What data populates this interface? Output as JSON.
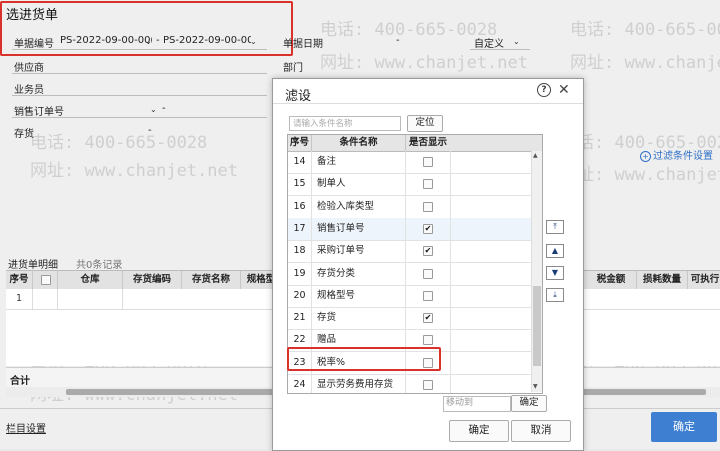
{
  "page": {
    "title": "选进货单",
    "fields": {
      "doc_no_label": "单据编号",
      "doc_no_from": "PS-2022-09-00-00(",
      "doc_no_to": "PS-2022-09-00-00(",
      "doc_date_label": "单据日期",
      "doc_date_sep": "-",
      "custom_label": "自定义",
      "supplier_label": "供应商",
      "department_label": "部门",
      "salesman_label": "业务员",
      "sales_order_label": "销售订单号",
      "sales_order_sep": "-",
      "stock_label": "存货",
      "stock_sep": "-"
    },
    "filter_setting_link": "过滤条件设置",
    "detail": {
      "tab_label": "进货单明细",
      "record_count": "共0条记录",
      "columns": [
        "序号",
        "仓库",
        "存货编码",
        "存货名称",
        "规格型",
        "税金额",
        "损耗数量",
        "可执行"
      ],
      "row_number": "1",
      "total_label": "合计"
    },
    "column_settings_link": "栏目设置",
    "confirm_button": "确定",
    "watermark": {
      "phone": "电话: 400-665-0028",
      "site": "网址: www.chanjet.net"
    }
  },
  "dialog": {
    "title": "滤设",
    "help_icon": "?",
    "close_icon": "✕",
    "search_placeholder": "请输入条件名称",
    "locate_button": "定位",
    "columns": {
      "seq": "序号",
      "name": "条件名称",
      "show": "是否显示"
    },
    "rows": [
      {
        "seq": "14",
        "name": "备注",
        "checked": false
      },
      {
        "seq": "15",
        "name": "制单人",
        "checked": false
      },
      {
        "seq": "16",
        "name": "检验入库类型",
        "checked": false
      },
      {
        "seq": "17",
        "name": "销售订单号",
        "checked": true
      },
      {
        "seq": "18",
        "name": "采购订单号",
        "checked": true
      },
      {
        "seq": "19",
        "name": "存货分类",
        "checked": false
      },
      {
        "seq": "20",
        "name": "规格型号",
        "checked": false
      },
      {
        "seq": "21",
        "name": "存货",
        "checked": true
      },
      {
        "seq": "22",
        "name": "赠品",
        "checked": false
      },
      {
        "seq": "23",
        "name": "税率%",
        "checked": false
      },
      {
        "seq": "24",
        "name": "显示劳务费用存货",
        "checked": false
      }
    ],
    "move_to_placeholder": "移动到",
    "move_confirm_button": "确定",
    "ok_button": "确定",
    "cancel_button": "取消",
    "side_arrows": [
      "⤒",
      "▲",
      "▼",
      "⤓"
    ]
  },
  "colors": {
    "highlight_red": "#d9322b",
    "primary_blue": "#3f7fd2",
    "link_blue": "#2f6fc8"
  }
}
